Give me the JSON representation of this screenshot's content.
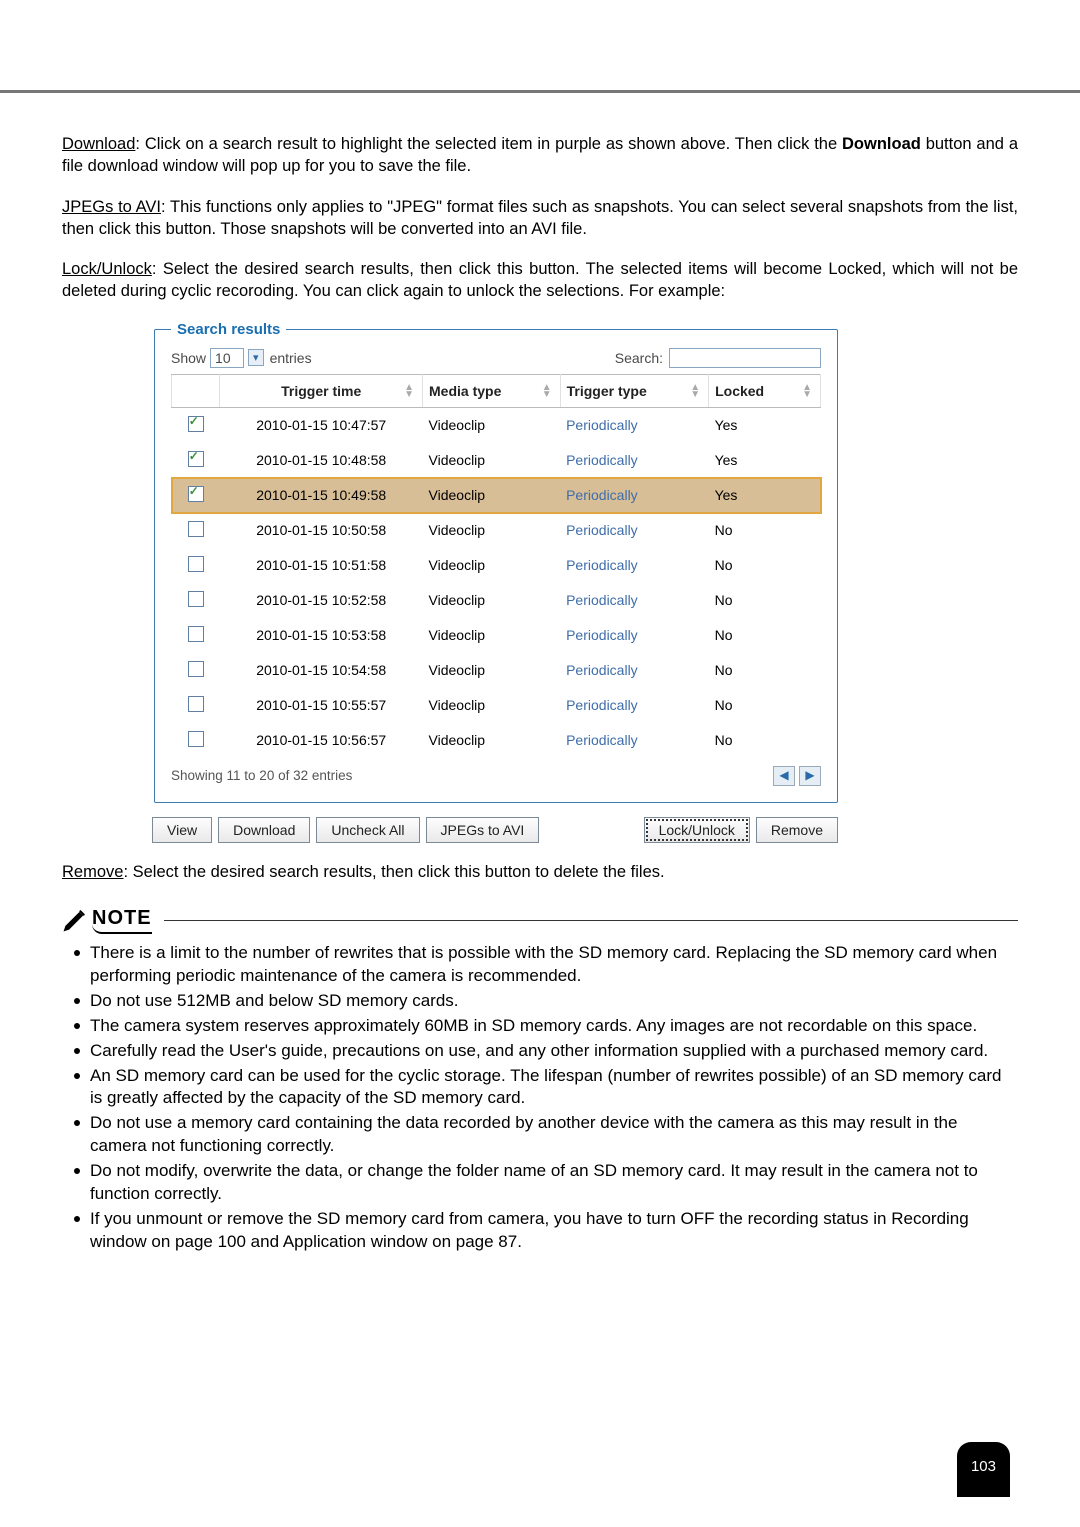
{
  "paragraphs": {
    "download_label": "Download",
    "download_body_1": ": Click on a search result to highlight the selected item in purple as shown above. Then click the ",
    "download_bold": "Download",
    "download_body_2": " button and a file download window will pop up for you to save the file.",
    "jpegs_label": "JPEGs to AVI",
    "jpegs_body": ": This functions only applies to \"JPEG\" format files such as snapshots. You can select several snapshots from the list, then click this button. Those snapshots will be converted into an AVI file.",
    "lock_label": "Lock/Unlock",
    "lock_body": ": Select the desired search results, then click this button. The selected items will become Locked, which will not be deleted during cyclic recoroding. You can click again to unlock the selections. For example:",
    "remove_label": "Remove",
    "remove_body": ": Select the desired search results, then click this button to delete the files."
  },
  "search_results": {
    "legend": "Search results",
    "show_label": "Show",
    "show_value": "10",
    "entries_label": "entries",
    "search_label": "Search:",
    "columns": {
      "trigger_time": "Trigger time",
      "media_type": "Media type",
      "trigger_type": "Trigger type",
      "locked": "Locked"
    },
    "rows": [
      {
        "checked": true,
        "selected": false,
        "trigger_time": "2010-01-15 10:47:57",
        "media_type": "Videoclip",
        "trigger_type": "Periodically",
        "locked": "Yes"
      },
      {
        "checked": true,
        "selected": false,
        "trigger_time": "2010-01-15 10:48:58",
        "media_type": "Videoclip",
        "trigger_type": "Periodically",
        "locked": "Yes"
      },
      {
        "checked": true,
        "selected": true,
        "trigger_time": "2010-01-15 10:49:58",
        "media_type": "Videoclip",
        "trigger_type": "Periodically",
        "locked": "Yes"
      },
      {
        "checked": false,
        "selected": false,
        "trigger_time": "2010-01-15 10:50:58",
        "media_type": "Videoclip",
        "trigger_type": "Periodically",
        "locked": "No"
      },
      {
        "checked": false,
        "selected": false,
        "trigger_time": "2010-01-15 10:51:58",
        "media_type": "Videoclip",
        "trigger_type": "Periodically",
        "locked": "No"
      },
      {
        "checked": false,
        "selected": false,
        "trigger_time": "2010-01-15 10:52:58",
        "media_type": "Videoclip",
        "trigger_type": "Periodically",
        "locked": "No"
      },
      {
        "checked": false,
        "selected": false,
        "trigger_time": "2010-01-15 10:53:58",
        "media_type": "Videoclip",
        "trigger_type": "Periodically",
        "locked": "No"
      },
      {
        "checked": false,
        "selected": false,
        "trigger_time": "2010-01-15 10:54:58",
        "media_type": "Videoclip",
        "trigger_type": "Periodically",
        "locked": "No"
      },
      {
        "checked": false,
        "selected": false,
        "trigger_time": "2010-01-15 10:55:57",
        "media_type": "Videoclip",
        "trigger_type": "Periodically",
        "locked": "No"
      },
      {
        "checked": false,
        "selected": false,
        "trigger_time": "2010-01-15 10:56:57",
        "media_type": "Videoclip",
        "trigger_type": "Periodically",
        "locked": "No"
      }
    ],
    "status": "Showing 11 to 20 of 32 entries",
    "buttons": {
      "view": "View",
      "download": "Download",
      "uncheck": "Uncheck All",
      "jpegs": "JPEGs to AVI",
      "lock": "Lock/Unlock",
      "remove": "Remove"
    }
  },
  "note": {
    "heading": "NOTE",
    "items": [
      "There is a limit to the number of rewrites that is possible with the SD memory card. Replacing the SD memory card when performing periodic maintenance of the camera is recommended.",
      "Do not use 512MB and below SD memory cards.",
      "The camera system reserves approximately 60MB in SD memory cards. Any images are not recordable on this space.",
      "Carefully read the User's guide, precautions on use, and any other information supplied with a purchased memory card.",
      "An SD memory card can be used for the cyclic storage. The lifespan (number of rewrites possible) of an SD memory card is greatly affected by the capacity of the SD memory card.",
      "Do not use a memory card containing the data recorded by another device with the camera as this may result in the camera not functioning correctly.",
      "Do not modify, overwrite the data, or change the folder name of an SD memory card. It may result in the camera not to function correctly.",
      "If you unmount or remove the SD memory card from camera, you have to turn OFF the recording status in Recording window on page 100 and Application window on page 87."
    ]
  },
  "page_number": "103"
}
